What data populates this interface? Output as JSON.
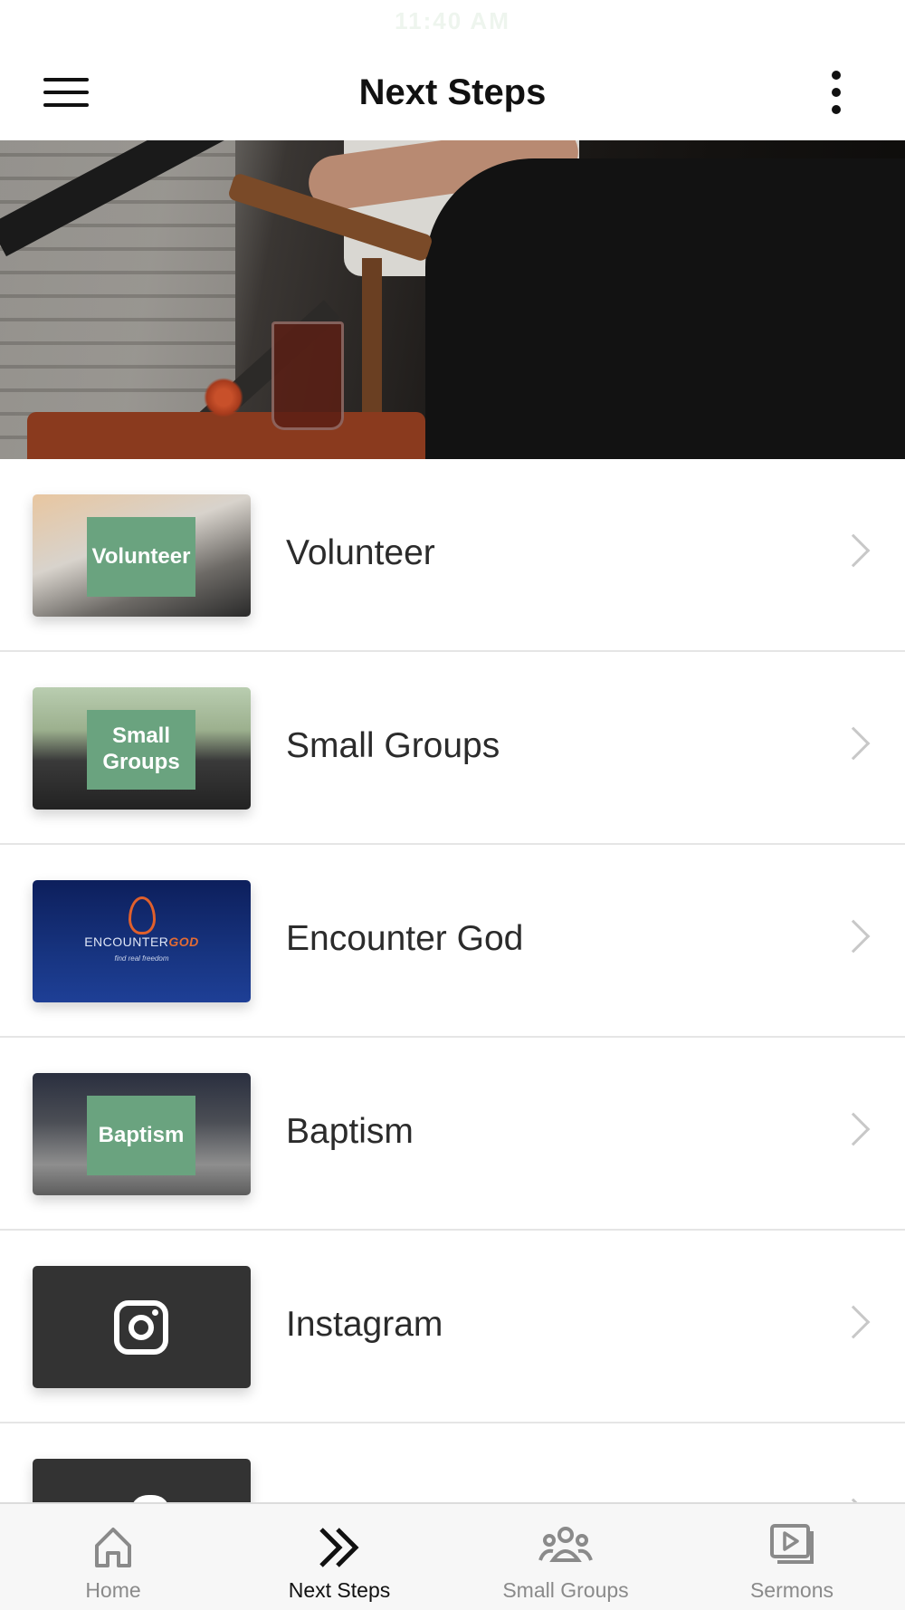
{
  "status_bar": {
    "time": "11:40 AM"
  },
  "header": {
    "title": "Next Steps"
  },
  "list": {
    "items": [
      {
        "label": "Volunteer",
        "thumb_text": "Volunteer"
      },
      {
        "label": "Small Groups",
        "thumb_text": "Small Groups"
      },
      {
        "label": "Encounter God",
        "thumb_logo_a": "ENCOUNTER",
        "thumb_logo_b": "GOD",
        "thumb_tagline": "find real freedom"
      },
      {
        "label": "Baptism",
        "thumb_text": "Baptism"
      },
      {
        "label": "Instagram",
        "thumb_icon": "instagram-icon"
      },
      {
        "label": "",
        "thumb_icon": "twitter-icon"
      }
    ]
  },
  "tabbar": {
    "tabs": [
      {
        "label": "Home",
        "icon": "home-icon",
        "active": false
      },
      {
        "label": "Next Steps",
        "icon": "double-chevron-right-icon",
        "active": true
      },
      {
        "label": "Small Groups",
        "icon": "group-icon",
        "active": false
      },
      {
        "label": "Sermons",
        "icon": "video-library-icon",
        "active": false
      }
    ]
  },
  "colors": {
    "accent_green": "#6aa37f",
    "active_tab": "#111111",
    "inactive_tab": "#8a8a8a"
  }
}
